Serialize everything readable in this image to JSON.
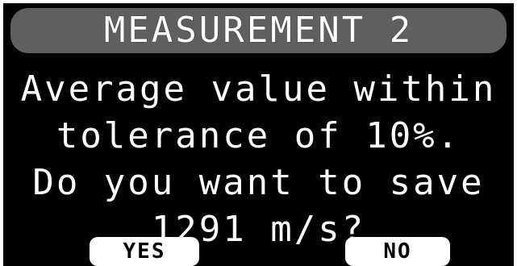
{
  "title": "MEASUREMENT 2",
  "message": {
    "line1": "Average value within",
    "line2": "tolerance of 10%.",
    "line3": "Do you want to save",
    "line4": "1291 m/s?"
  },
  "buttons": {
    "yes_label": "YES",
    "no_label": "NO"
  },
  "colors": {
    "background": "#000000",
    "title_bar": "#5f5f5f",
    "text": "#ffffff",
    "button_bg": "#ffffff",
    "button_text": "#000000"
  }
}
